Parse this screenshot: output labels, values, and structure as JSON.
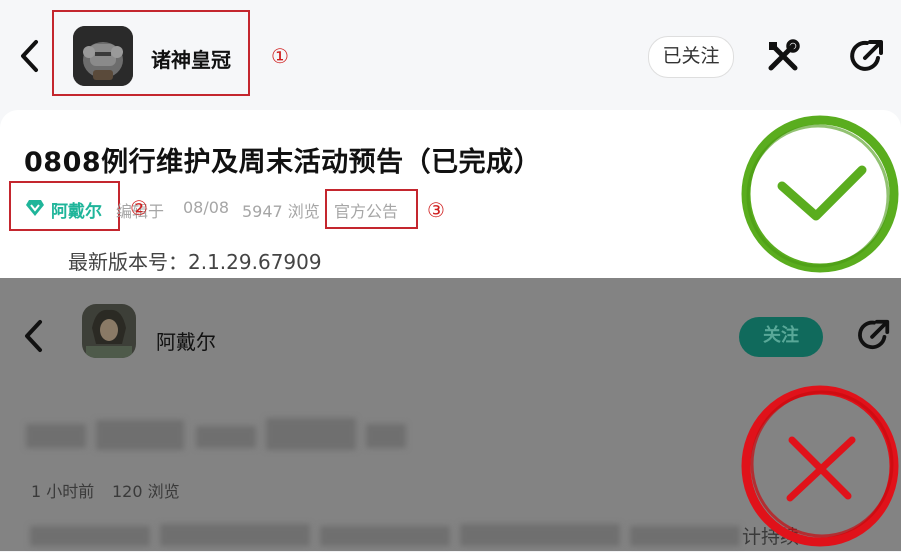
{
  "top": {
    "game_name": "诸神皇冠",
    "follow_status": "已关注",
    "post_title": "0808例行维护及周末活动预告（已完成）",
    "author": "阿戴尔",
    "meta_prefix": "编辑于",
    "date": "08/08",
    "views": "5947 浏览",
    "category": "官方公告",
    "version_line": "最新版本号：2.1.29.67909",
    "annotations": [
      "①",
      "②",
      "③"
    ]
  },
  "bottom": {
    "author": "阿戴尔",
    "follow_label": "关注",
    "time": "1 小时前",
    "views": "120 浏览",
    "trailing_text": "计持续"
  },
  "verdict": {
    "top": "check",
    "bottom": "cross"
  },
  "colors": {
    "annotation_red": "#c4262e",
    "author_teal": "#1fb59a",
    "check_green": "#5aad1e",
    "cross_red": "#e0121a"
  }
}
